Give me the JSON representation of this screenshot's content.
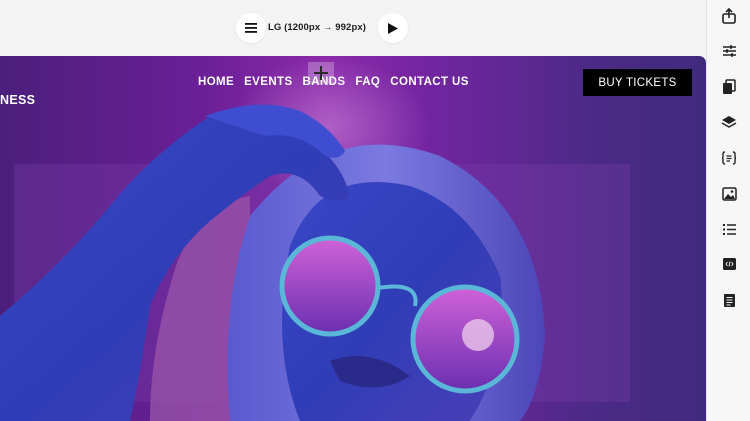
{
  "toolbar": {
    "breakpoint_label": "LG (1200px → 992px)",
    "menu_icon": "hamburger-menu-icon",
    "preview_icon": "play-icon"
  },
  "sidebar": {
    "icons": [
      "export-icon",
      "sliders-icon",
      "pages-icon",
      "layers-icon",
      "variables-icon",
      "image-icon",
      "list-icon",
      "code-icon",
      "notes-icon"
    ]
  },
  "site": {
    "hero_text": "NESS",
    "nav": [
      "HOME",
      "EVENTS",
      "BANDS",
      "FAQ",
      "CONTACT US"
    ],
    "buy_label": "BUY TICKETS"
  },
  "colors": {
    "accent": "#000000",
    "hero_purple": "#6a1f96",
    "hero_blue": "#3d3fd0"
  }
}
